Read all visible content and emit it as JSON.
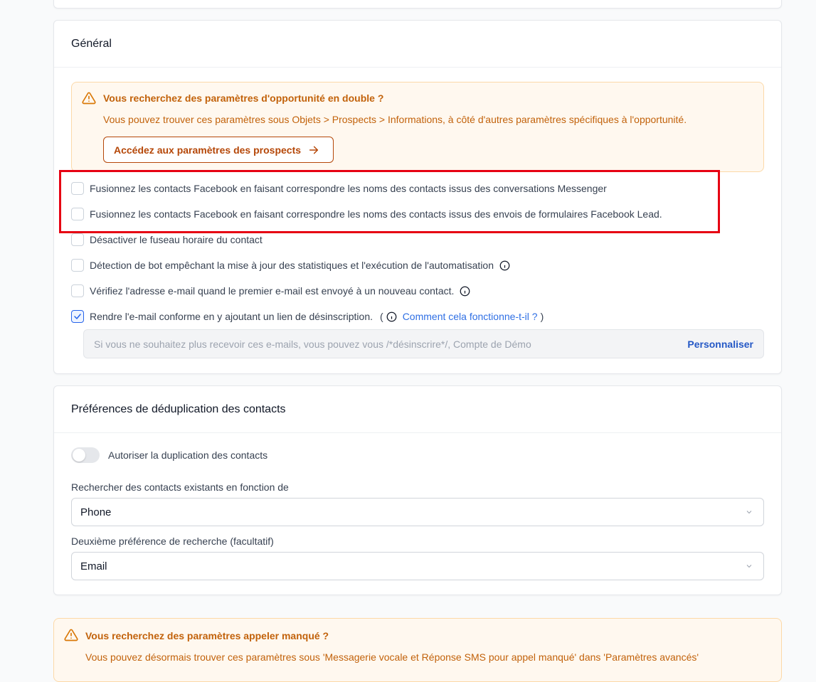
{
  "general": {
    "title": "Général",
    "alert": {
      "title": "Vous recherchez des paramètres d'opportunité en double ?",
      "description": "Vous pouvez trouver ces paramètres sous Objets > Prospects > Informations, à côté d'autres paramètres spécifiques à l'opportunité.",
      "button_label": "Accédez aux paramètres des prospects",
      "icon": "warning-triangle-icon"
    },
    "options": [
      {
        "label": "Fusionnez les contacts Facebook en faisant correspondre les noms des contacts issus des conversations Messenger",
        "checked": false
      },
      {
        "label": "Fusionnez les contacts Facebook en faisant correspondre les noms des contacts issus des envois de formulaires Facebook Lead.",
        "checked": false
      },
      {
        "label": "Désactiver le fuseau horaire du contact",
        "checked": false
      },
      {
        "label": "Détection de bot empêchant la mise à jour des statistiques et l'exécution de l'automatisation",
        "checked": false
      },
      {
        "label": "Vérifiez l'adresse e-mail quand le premier e-mail est envoyé à un nouveau contact.",
        "checked": false
      },
      {
        "label": "Rendre l'e-mail conforme en y ajoutant un lien de désinscription.",
        "checked": true
      }
    ],
    "paren_open": "(",
    "paren_close": ")",
    "how_it_works_link": "Comment cela fonctionne-t-il ?",
    "unsubscribe_text": "Si vous ne souhaitez plus recevoir ces e-mails, vous pouvez vous /*désinscrire*/, Compte de Démo",
    "customize_label": "Personnaliser"
  },
  "dedup": {
    "title": "Préférences de déduplication des contacts",
    "allow_duplicates_label": "Autoriser la duplication des contacts",
    "allow_duplicates_on": false,
    "search_label": "Rechercher des contacts existants en fonction de",
    "search_value": "Phone",
    "second_label": "Deuxième préférence de recherche (facultatif)",
    "second_value": "Email"
  },
  "missed_call_alert": {
    "title": "Vous recherchez des paramètres appeler manqué ?",
    "description": "Vous pouvez désormais trouver ces paramètres sous 'Messagerie vocale et Réponse SMS pour appel manqué' dans 'Paramètres avancés'"
  },
  "colors": {
    "accent": "#2f6fe4",
    "warning": "#c2620b",
    "highlight_border": "#e60012"
  }
}
